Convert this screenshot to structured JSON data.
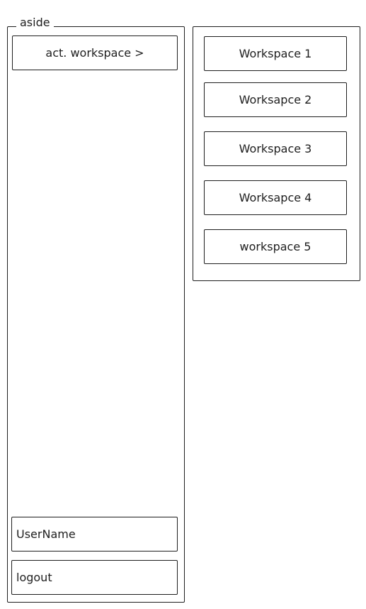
{
  "aside": {
    "title": "aside",
    "active_workspace_label": "act. workspace >",
    "username_label": "UserName",
    "logout_label": "logout"
  },
  "workspace_panel": {
    "items": [
      {
        "label": "Workspace 1"
      },
      {
        "label": "Worksapce 2"
      },
      {
        "label": "Workspace 3"
      },
      {
        "label": "Worksapce 4"
      },
      {
        "label": "workspace 5"
      }
    ]
  }
}
